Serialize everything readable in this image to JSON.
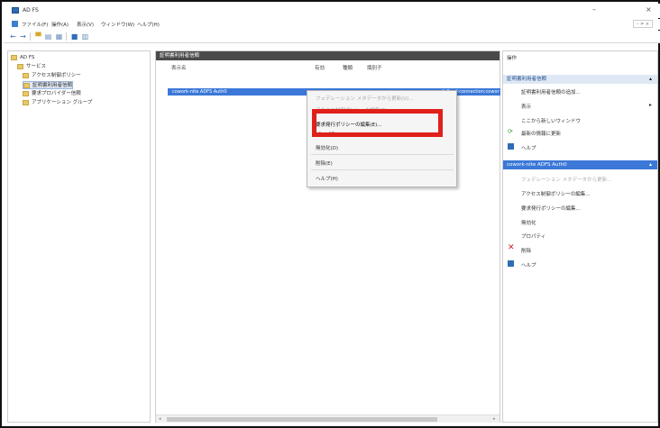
{
  "window": {
    "title": "AD FS",
    "minimize": "–",
    "close": "×"
  },
  "menu": {
    "items": [
      "ファイル(F)",
      "操作(A)",
      "表示(V)",
      "ウィンドウ(W)",
      "ヘルプ(H)"
    ],
    "mdi": "– ≠ ×"
  },
  "tree": {
    "items": [
      {
        "label": "AD FS"
      },
      {
        "label": "サービス"
      },
      {
        "label": "アクセス制御ポリシー"
      },
      {
        "label": "証明書利用者信頼"
      },
      {
        "label": "要求プロバイダー信頼"
      },
      {
        "label": "アプリケーション グループ"
      }
    ]
  },
  "center": {
    "header": "証明書利用者信頼",
    "columns": [
      "表示名",
      "有効",
      "種類",
      "識別子"
    ],
    "row": {
      "name": "cowork-nite ADFS Auth0",
      "identifier": "urn:auth0:oyl:connection:cowork"
    }
  },
  "context_menu": {
    "items": [
      {
        "label": "フェデレーション メタデータから更新(U)...",
        "disabled": true
      },
      {
        "label": "アクセス制御ポリシーの編集(P)...",
        "disabled": true
      },
      {
        "label": "要求発行ポリシーの編集(E)...",
        "disabled": false
      },
      {
        "label": "無効化(D)",
        "disabled": false
      },
      {
        "label": "プロパティ",
        "disabled": false
      },
      {
        "label": "削除(E)",
        "disabled": false
      },
      {
        "label": "ヘルプ(H)",
        "disabled": false
      }
    ]
  },
  "actions": {
    "top_label": "操作",
    "section1": {
      "title": "証明書利用者信頼",
      "items": [
        "証明書利用者信頼の追加...",
        "表示",
        "ここから新しいウィンドウ",
        "最新の情報に更新",
        "ヘルプ"
      ]
    },
    "section2": {
      "title": "cowork-nite ADFS Auth0",
      "items": [
        "フェデレーション メタデータから更新...",
        "アクセス制御ポリシーの編集...",
        "要求発行ポリシーの編集...",
        "無効化",
        "プロパティ",
        "削除",
        "ヘルプ"
      ]
    }
  },
  "colors": {
    "accent": "#3b78d8",
    "highlight": "#e0201b",
    "delete": "#d0231d"
  }
}
